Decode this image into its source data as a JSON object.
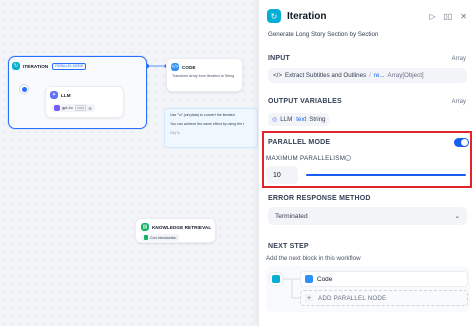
{
  "canvas": {
    "iteration_node": {
      "title": "ITERATION",
      "badge": "PARALLEL MODE",
      "toolbar": "· · ·",
      "llm_node": {
        "title": "LLM",
        "model_name": "gpt-4o",
        "model_tag": "CHAT",
        "settings_glyph": "⚙"
      }
    },
    "code_node": {
      "title": "CODE",
      "description": "Transform Array from Iteration to String"
    },
    "note": {
      "line1": "Use \"\\n\".join(data) to convert the iterated",
      "line2": "You can achieve the same effect by using the t",
      "line3": "DifyTo"
    },
    "knowledge_node": {
      "title": "KNOWLEDGE RETRIEVAL",
      "item": "Con Introduction"
    }
  },
  "panel": {
    "title": "Iteration",
    "actions": [
      "▷",
      "▯▯",
      "✕"
    ],
    "description": "Generate Long Story Section by Section",
    "input": {
      "label": "INPUT",
      "type": "Array",
      "source": "Extract Subtitles and Outlines",
      "separator": "/",
      "variable": "re...",
      "var_type": "Array[Object]"
    },
    "output": {
      "label": "OUTPUT VARIABLES",
      "type": "Array",
      "var_name": "LLM",
      "var_type": "text",
      "var_kind": "String"
    },
    "parallel": {
      "label": "PARALLEL MODE",
      "enabled": true,
      "max_label": "MAXIMUM PARALLELISM",
      "max_value": "10",
      "slider_fraction": 1.0
    },
    "error": {
      "label": "ERROR RESPONSE METHOD",
      "value": "Terminated",
      "chevron": "⌄"
    },
    "next_step": {
      "label": "NEXT STEP",
      "description": "Add the next block in this workflow",
      "node": "Code",
      "add_label": "ADD PARALLEL NODE",
      "plus": "+"
    }
  },
  "colors": {
    "accent": "#155eef",
    "iteration": "#06aed4",
    "llm": "#6172f3",
    "code": "#2e90fa",
    "knowledge": "#16b364",
    "highlight": "#e0242b"
  }
}
